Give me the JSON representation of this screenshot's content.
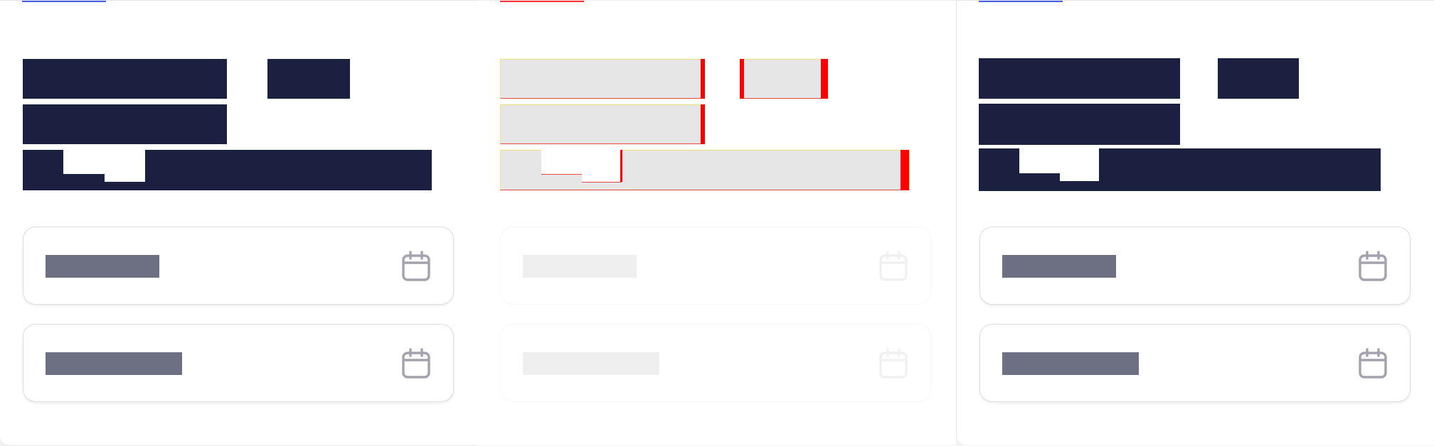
{
  "colors": {
    "ink_block": "#1c2040",
    "field_value_bar": "#6d6f82",
    "field_border": "#dcdce3",
    "icon_stroke": "#a3a3b0",
    "tab_accent_blue": "#4057e0",
    "tab_accent_red": "#ff2a2a",
    "debug_mark_red": "#ff0000",
    "debug_outline_yellow": "#f1e37a"
  },
  "icons": {
    "calendar": "calendar-icon"
  },
  "panels": [
    {
      "variant": "rendered",
      "tab_accent": "blue",
      "fields": [
        {
          "label": "start-date",
          "value": ""
        },
        {
          "label": "end-date",
          "value": ""
        }
      ]
    },
    {
      "variant": "debug-overlay",
      "tab_accent": "red",
      "fields": [
        {
          "label": "start-date",
          "value": ""
        },
        {
          "label": "end-date",
          "value": ""
        }
      ]
    },
    {
      "variant": "rendered",
      "tab_accent": "blue",
      "fields": [
        {
          "label": "start-date",
          "value": ""
        },
        {
          "label": "end-date",
          "value": ""
        }
      ]
    }
  ]
}
